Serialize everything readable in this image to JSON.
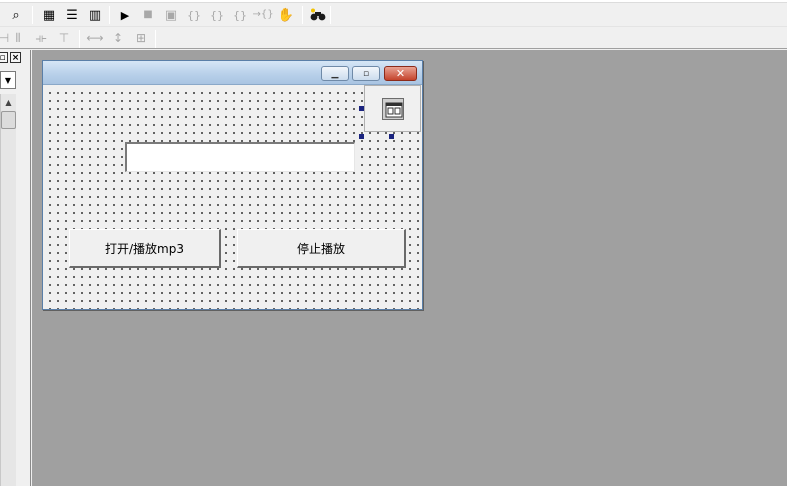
{
  "toolbar1": {
    "icons": [
      "find-icon",
      "layout-grid-icon",
      "layout-rows-icon",
      "layout-columns-icon",
      "play-icon",
      "stop-icon",
      "breakpoint-icon",
      "step-into-icon",
      "step-over-icon",
      "step-out-icon",
      "run-to-cursor-icon",
      "hand-icon",
      "binoculars-icon"
    ],
    "glyphs": {
      "find": "⌕",
      "grid": "▦",
      "rows": "☰",
      "cols": "▥",
      "play": "▶",
      "stop": "■",
      "bp": "▣",
      "step_into": "{}",
      "step_over": "{}",
      "step_out": "{}",
      "run_cursor": "→{}",
      "hand": "✋",
      "binoculars": "☄"
    }
  },
  "toolbar2": {
    "glyphs": {
      "align_a": "⊣",
      "align_b": "⫴",
      "space_h": "⟛",
      "space_v": "⊤",
      "same_w": "⟷",
      "same_h": "↕",
      "center": "⊞"
    }
  },
  "left_panel": {
    "restore_glyph": "▫",
    "close_glyph": "×",
    "combo_arrow": "▼",
    "scroll_up_glyph": "▲"
  },
  "form": {
    "title": "",
    "minimize_glyph": "▁",
    "maximize_glyph": "▫",
    "close_glyph": "✕",
    "textbox_value": "",
    "buttons": {
      "open_play_label": "打开/播放mp3",
      "stop_play_label": "停止播放"
    }
  },
  "colors": {
    "workspace": "#a0a0a0",
    "titlebar": "#b9d1ea",
    "selection_handle": "#1a237e",
    "close_button": "#c4432c"
  }
}
